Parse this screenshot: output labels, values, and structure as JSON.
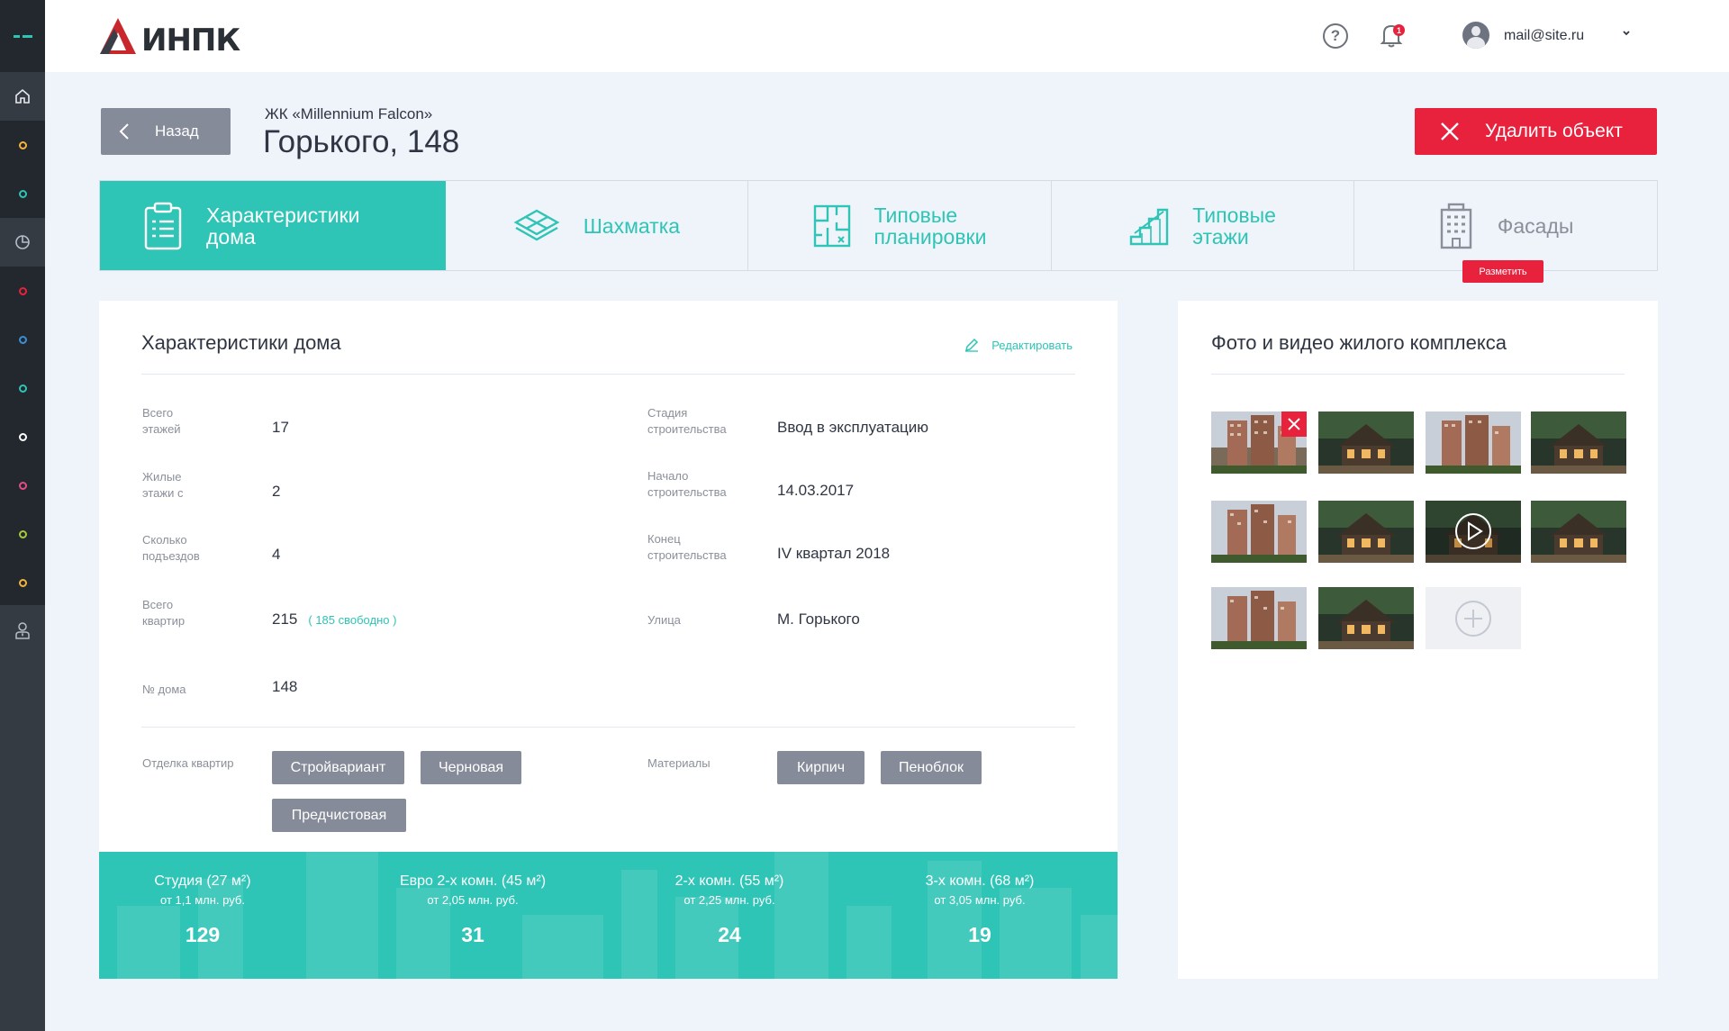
{
  "brand": {
    "logo_text": "ИНПК"
  },
  "header": {
    "user_email": "mail@site.ru",
    "notification_count": "1",
    "help_label": "?"
  },
  "page": {
    "back_label": "Назад",
    "subtitle": "ЖК «Millennium Falcon»",
    "title": "Горького, 148",
    "delete_label": "Удалить объект"
  },
  "tabs": [
    {
      "label_1": "Характеристики",
      "label_2": "дома",
      "icon": "clipboard-icon",
      "active": true
    },
    {
      "label_1": "Шахматка",
      "label_2": "",
      "icon": "layers-icon",
      "active": false
    },
    {
      "label_1": "Типовые",
      "label_2": "планировки",
      "icon": "floorplan-icon",
      "active": false
    },
    {
      "label_1": "Типовые",
      "label_2": "этажи",
      "icon": "stairs-icon",
      "active": false
    },
    {
      "label_1": "Фасады",
      "label_2": "",
      "icon": "building-icon",
      "active": false
    }
  ],
  "facade_tag": "Разметить",
  "characteristics": {
    "title": "Характеристики дома",
    "edit_label": "Редактировать",
    "left": [
      {
        "label_1": "Всего",
        "label_2": "этажей",
        "value": "17"
      },
      {
        "label_1": "Жилые",
        "label_2": "этажи с",
        "value": "2"
      },
      {
        "label_1": "Сколько",
        "label_2": "подъездов",
        "value": "4"
      },
      {
        "label_1": "Всего",
        "label_2": "квартир",
        "value": "215",
        "note": "( 185 свободно )"
      },
      {
        "label_1": "№ дома",
        "label_2": "",
        "value": "148"
      }
    ],
    "right": [
      {
        "label_1": "Стадия",
        "label_2": "строительства",
        "value": "Ввод в эксплуатацию"
      },
      {
        "label_1": "Начало",
        "label_2": "строительства",
        "value": "14.03.2017"
      },
      {
        "label_1": "Конец",
        "label_2": "строительства",
        "value": "IV квартал 2018"
      },
      {
        "label_1": "Улица",
        "label_2": "",
        "value": "М. Горького"
      }
    ],
    "finish_label": "Отделка квартир",
    "finish_options": [
      "Стройвариант",
      "Черновая",
      "Предчистовая"
    ],
    "materials_label": "Материалы",
    "materials": [
      "Кирпич",
      "Пеноблок"
    ]
  },
  "stats": [
    {
      "name": "Студия (27 м²)",
      "price": "от 1,1 млн. руб.",
      "count": "129"
    },
    {
      "name": "Евро 2-х комн. (45 м²)",
      "price": "от 2,05 млн. руб.",
      "count": "31"
    },
    {
      "name": "2-х комн. (55 м²)",
      "price": "от 2,25 млн. руб.",
      "count": "24"
    },
    {
      "name": "3-х комн. (68 м²)",
      "price": "от 3,05 млн. руб.",
      "count": "19"
    }
  ],
  "media": {
    "title": "Фото и видео жилого комплекса",
    "items": [
      "photo-tower",
      "photo-house",
      "photo-tower",
      "photo-house",
      "photo-tower",
      "photo-house",
      "video-house",
      "photo-house",
      "photo-tower",
      "photo-house"
    ]
  },
  "colors": {
    "accent": "#2ec4b6",
    "danger": "#e8213d",
    "chip": "#858b99",
    "sidebar": "#22282e"
  }
}
